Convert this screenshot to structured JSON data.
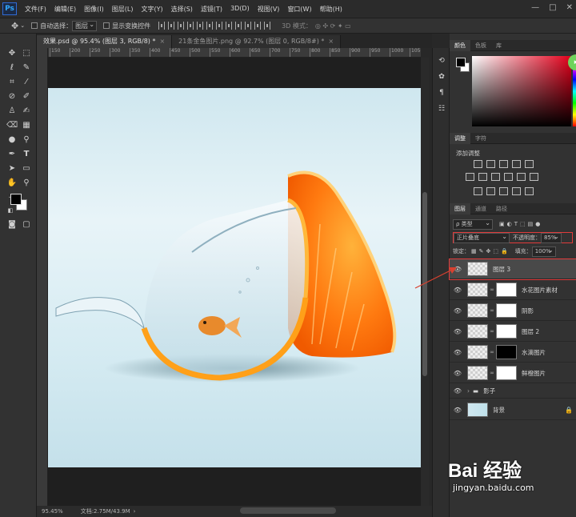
{
  "app": {
    "logo": "Ps"
  },
  "menu": [
    "文件(F)",
    "编辑(E)",
    "图像(I)",
    "图层(L)",
    "文字(Y)",
    "选择(S)",
    "滤镜(T)",
    "3D(D)",
    "视图(V)",
    "窗口(W)",
    "帮助(H)"
  ],
  "window_controls": [
    "—",
    "□",
    "✕"
  ],
  "options": {
    "auto_select_label": "自动选择：",
    "auto_select_value": "图层",
    "show_transform_label": "显示变换控件",
    "mode_3d_label": "3D 模式："
  },
  "tabs": [
    {
      "label": "效果.psd @ 95.4% (图层 3, RGB/8) *",
      "active": true
    },
    {
      "label": "21条金鱼图片.png @ 92.7% (图层 0, RGB/8#) *",
      "active": false
    }
  ],
  "ruler_ticks": [
    "150",
    "200",
    "250",
    "300",
    "350",
    "400",
    "450",
    "500",
    "550",
    "600",
    "650",
    "700",
    "750",
    "800",
    "850",
    "900",
    "950",
    "1000",
    "1050"
  ],
  "status": {
    "zoom": "95.45%",
    "doc": "文档:2.75M/43.9M"
  },
  "color_panel": {
    "tabs": [
      "颜色",
      "色板",
      "库"
    ]
  },
  "adjust_panel": {
    "tabs": [
      "调整",
      "字符"
    ],
    "title": "添加调整"
  },
  "layers_panel": {
    "tabs": [
      "图层",
      "通道",
      "路径"
    ],
    "filter_label": "ρ 类型",
    "blend_mode": "正片叠底",
    "opacity_label": "不透明度：",
    "opacity_value": "85%",
    "lock_label": "锁定：",
    "fill_label": "填充：",
    "fill_value": "100%",
    "layers": [
      {
        "name": "图层 3",
        "selected": true,
        "mask": "none",
        "type": "layer"
      },
      {
        "name": "水花图片素材",
        "selected": false,
        "mask": "white",
        "type": "layer"
      },
      {
        "name": "阴影",
        "selected": false,
        "mask": "white",
        "type": "layer"
      },
      {
        "name": "图层 2",
        "selected": false,
        "mask": "white",
        "type": "layer"
      },
      {
        "name": "水滴图片",
        "selected": false,
        "mask": "black",
        "type": "layer"
      },
      {
        "name": "鲜橙图片",
        "selected": false,
        "mask": "white",
        "type": "layer"
      },
      {
        "name": "影子",
        "selected": false,
        "mask": "none",
        "type": "group"
      },
      {
        "name": "背景",
        "selected": false,
        "mask": "none",
        "type": "background"
      }
    ]
  },
  "watermark": {
    "logo": "Bai 经验",
    "url": "jingyan.baidu.com"
  },
  "accent_colors": {
    "selection_border": "#e03b3b",
    "ps_blue": "#31a8ff",
    "panel_bg": "#323232"
  }
}
